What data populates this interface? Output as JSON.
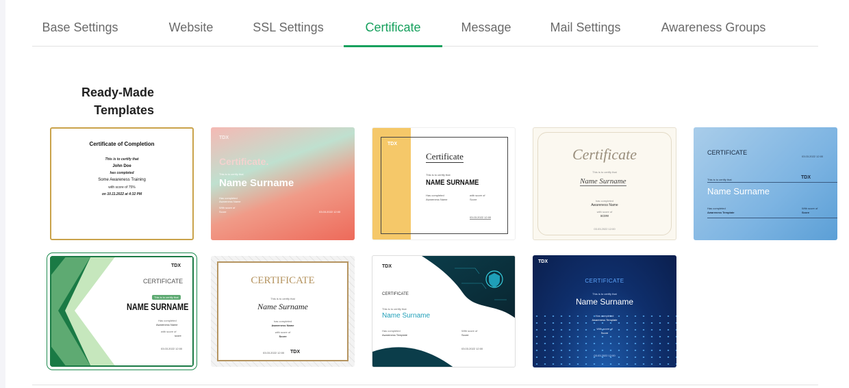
{
  "tabs": [
    {
      "label": "Base Settings"
    },
    {
      "label": "Website"
    },
    {
      "label": "SSL Settings"
    },
    {
      "label": "Certificate"
    },
    {
      "label": "Message"
    },
    {
      "label": "Mail Settings"
    },
    {
      "label": "Awareness Groups"
    }
  ],
  "active_tab": "Certificate",
  "section": {
    "title": "Ready-Made Templates"
  },
  "colors": {
    "accent": "#16a05d",
    "tab_text": "#6a6a6a"
  },
  "templates": {
    "t1": {
      "title": "Certificate of Completion",
      "line1": "This is to certify that",
      "name": "John Doe",
      "line2": "has completed",
      "training": "Some Awareness Training",
      "score": "with score of 75%",
      "date": "on 10.11.2022 at 4:32 PM"
    },
    "t2": {
      "logo": "TDX",
      "title": "Certificate.",
      "certify": "This is to certify that",
      "name": "Name Surname",
      "has_completed": "Has completed",
      "awareness": "Awareness Name",
      "with_score": "With score of",
      "score": "Score",
      "date": "03.03.2022 12:00"
    },
    "t3": {
      "logo": "TDX",
      "title": "Certificate",
      "certify": "This is to certify that",
      "name": "NAME SURNAME",
      "has_completed": "Has completed",
      "awareness": "Awareness Name",
      "with_score": "with score of",
      "score": "Score",
      "date": "03.03.2022 12:00"
    },
    "t4": {
      "title": "Certificate",
      "certify": "This is to certify that",
      "name": "Name Surname",
      "has_completed": "has completed",
      "awareness": "Awareness Name",
      "with_score": "with score of",
      "score": "score",
      "date": "03.03.2022 12:00"
    },
    "t5": {
      "title": "CERTIFICATE",
      "top_date": "03.03.2022 12:00",
      "certify": "This is to certify that",
      "logo": "TDX",
      "name": "Name Surname",
      "has_completed": "Has completed",
      "awareness": "Awareness Template",
      "with_score": "With score of",
      "score": "Score"
    },
    "t6": {
      "logo": "TDX",
      "title": "CERTIFICATE",
      "certify": "This is to certify that",
      "name": "NAME SURNAME",
      "has_completed": "Has completed",
      "awareness": "Awareness Name",
      "with_score": "with score of",
      "score": "score",
      "date": "03.03.2022 12:00"
    },
    "t7": {
      "title": "CERTIFICATE",
      "certify": "This is to certify that",
      "name": "Name Surname",
      "has_completed": "has completed",
      "awareness": "Awareness Name",
      "with_score": "with score of",
      "score": "Score",
      "date": "03.03.2022 12:00",
      "logo": "TDX"
    },
    "t8": {
      "logo": "TDX",
      "title": "CERTIFICATE",
      "certify": "This is to certify that",
      "name": "Name Surname",
      "has_completed": "Has completed",
      "awareness": "Awareness Template",
      "with_score": "With score of",
      "score": "Score",
      "date": "03.03.2022 12:00"
    },
    "t9": {
      "logo": "TDX",
      "title": "CERTIFICATE",
      "certify": "This is to certify that",
      "name": "Name Surname",
      "has_completed": "Has completed",
      "awareness": "Awareness Template",
      "with_score": "With score of",
      "score": "Score",
      "date": "03.03.2022 12:00"
    }
  }
}
